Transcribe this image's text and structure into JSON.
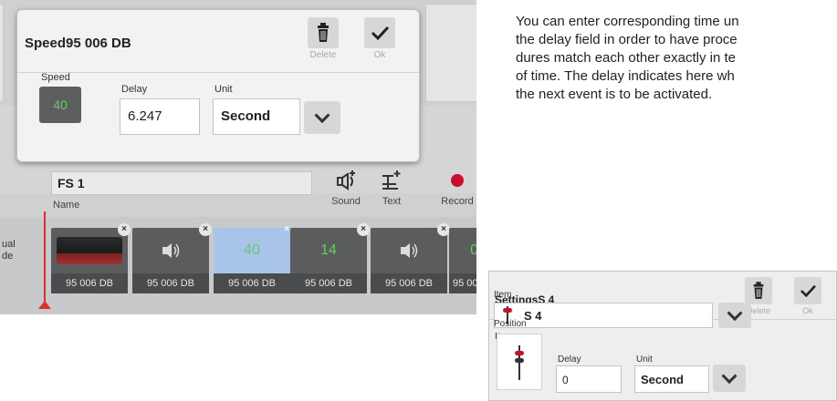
{
  "background_app": {
    "name_value": "FS 1",
    "name_label": "Name",
    "tools": [
      {
        "label": "Sound",
        "icon": "sound-add-icon"
      },
      {
        "label": "Text",
        "icon": "text-add-icon"
      },
      {
        "label": "Record",
        "icon": "record-icon"
      }
    ],
    "timeline_side_label": "ual\nde",
    "cards": [
      {
        "thumb": "locomotive-image",
        "caption": "95 006 DB"
      },
      {
        "thumb": "sound-icon",
        "caption": "95 006 DB"
      },
      {
        "thumb": "40",
        "thumb_color": "#5bd35b",
        "caption": "95 006 DB",
        "highlight": true
      },
      {
        "thumb": "14",
        "thumb_color": "#5bd35b",
        "caption": "95 006 DB"
      },
      {
        "thumb": "sound-icon",
        "caption": "95 006 DB"
      },
      {
        "thumb": "0",
        "thumb_color": "#5bd35b",
        "caption": "95 00"
      }
    ]
  },
  "speed_popup": {
    "title": "Speed95 006 DB",
    "delete_label": "Delete",
    "ok_label": "Ok",
    "speed_label": "Speed",
    "speed_value": "40",
    "delay_label": "Delay",
    "delay_value": "6.247",
    "unit_label": "Unit",
    "unit_value": "Second"
  },
  "info_text": "You can enter corresponding time un\nthe delay field in order to have proce\ndures match each other exactly in te\nof time. The delay indicates here wh\nthe next event is to be activated.",
  "settings_panel": {
    "title": "SettingsS 4",
    "delete_label": "Delete",
    "ok_label": "Ok",
    "item_label": "Item",
    "item_value": "S 4",
    "position_label": "Position",
    "delay_label": "Delay",
    "delay_value": "0",
    "unit_label": "Unit",
    "unit_value": "Second"
  },
  "colors": {
    "accent_red": "#c8102e",
    "speed_green": "#5bd35b",
    "highlight_blue": "#a8c4e8"
  }
}
